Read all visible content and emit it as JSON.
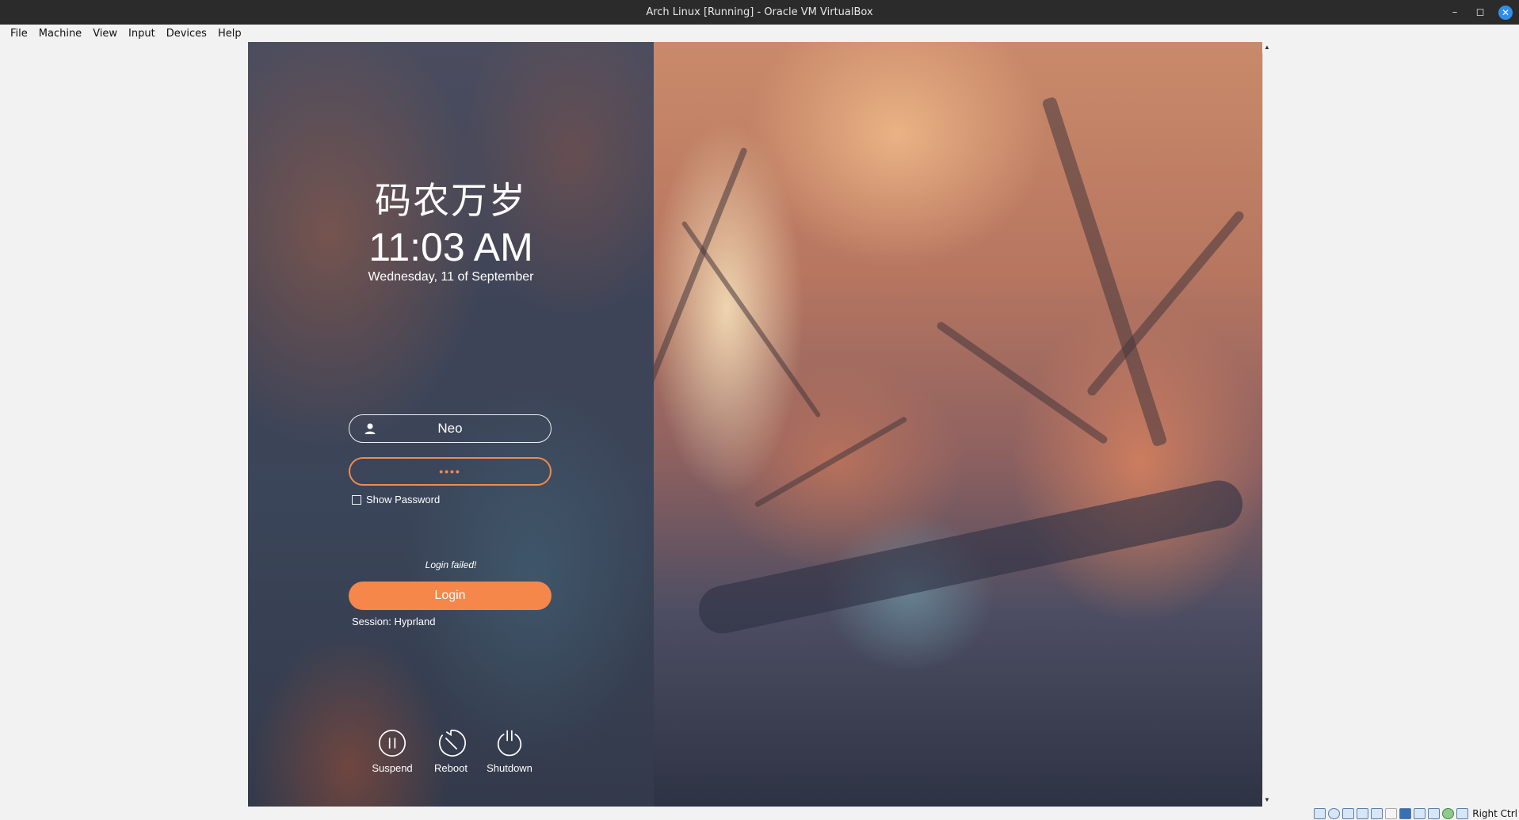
{
  "window": {
    "title": "Arch Linux [Running] - Oracle VM VirtualBox",
    "controls": {
      "minimize": "–",
      "restore": "◻",
      "close": "✕"
    }
  },
  "menubar": [
    "File",
    "Machine",
    "View",
    "Input",
    "Devices",
    "Help"
  ],
  "greeter": {
    "greeting": "码农万岁",
    "time": "11:03 AM",
    "date": "Wednesday, 11 of September",
    "username": "Neo",
    "password_mask": "••••",
    "show_password_label": "Show Password",
    "status": "Login failed!",
    "login_label": "Login",
    "session": "Session: Hyprland",
    "power": [
      {
        "label": "Suspend",
        "icon": "pause-circle-icon"
      },
      {
        "label": "Reboot",
        "icon": "reboot-icon"
      },
      {
        "label": "Shutdown",
        "icon": "power-icon"
      }
    ],
    "accent_color": "#f5874a"
  },
  "scrollbar": {
    "up": "▲",
    "down": "▼"
  },
  "tray": {
    "host_key_label": "Right Ctrl",
    "icons": [
      "hard-disk-icon",
      "optical-drive-icon",
      "audio-icon",
      "network-icon",
      "usb-icon",
      "shared-folder-icon",
      "display-icon",
      "recording-icon",
      "cpu-icon",
      "guest-additions-icon",
      "mouse-integration-icon"
    ]
  }
}
